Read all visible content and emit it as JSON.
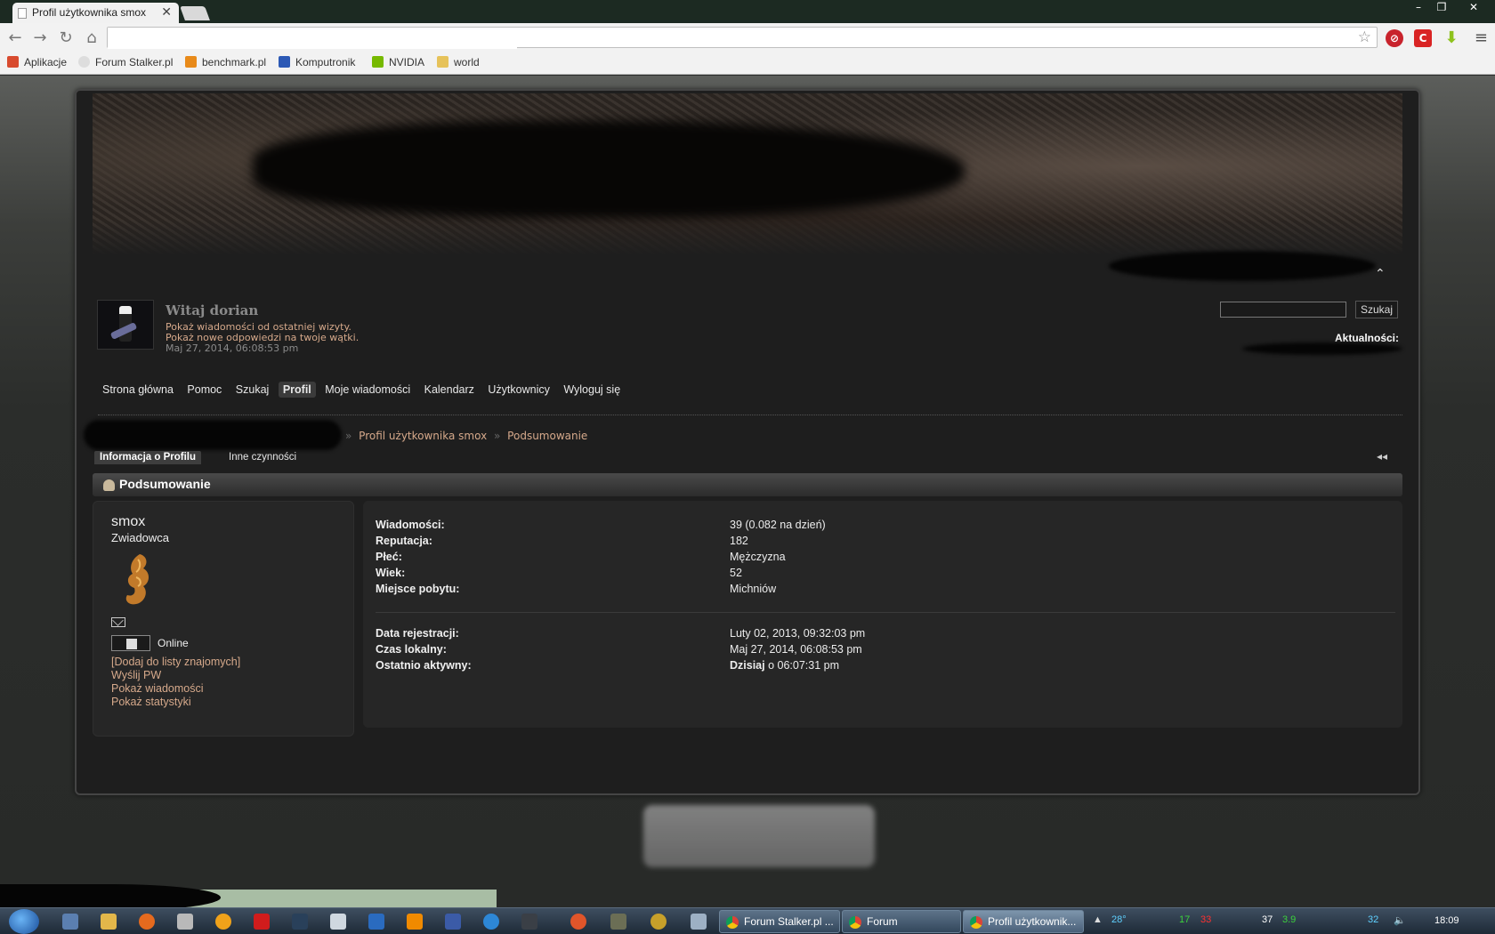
{
  "browser": {
    "tab_title": "Profil użytkownika smox",
    "tab_close": "✕",
    "window_controls": [
      "–",
      "❐",
      "✕"
    ],
    "nav_icons": [
      "back-icon",
      "forward-icon",
      "reload-icon",
      "home-icon"
    ],
    "nav_glyphs": [
      "←",
      "→",
      "↻",
      "⌂"
    ],
    "star_glyph": "☆",
    "menu_glyph": "≡",
    "extensions": [
      {
        "name": "adblock-icon",
        "glyph": "⊘",
        "color": "#c8232c"
      },
      {
        "name": "c-extension-icon",
        "glyph": "C",
        "color": "#d92424"
      },
      {
        "name": "download-icon",
        "glyph": "⬇",
        "color": "#8ec21d"
      }
    ],
    "bookmarks": [
      {
        "label": "Aplikacje",
        "icon": "apps-icon",
        "color": "#d84b2f"
      },
      {
        "label": "Forum Stalker.pl",
        "icon": "radiation-icon",
        "color": "#ffffff"
      },
      {
        "label": "benchmark.pl",
        "icon": "b-icon",
        "color": "#e88a1a"
      },
      {
        "label": "Komputronik",
        "icon": "star-icon",
        "color": "#2c59b5"
      },
      {
        "label": "NVIDIA",
        "icon": "nvidia-icon",
        "color": "#76b900"
      },
      {
        "label": "world",
        "icon": "folder-icon",
        "color": "#e6c25a"
      }
    ]
  },
  "page": {
    "header": {
      "collapse_glyph": "⌃",
      "greeting": "Witaj dorian",
      "links": [
        "Pokaż wiadomości od ostatniej wizyty.",
        "Pokaż nowe odpowiedzi na twoje wątki."
      ],
      "date": "Maj 27, 2014, 06:08:53 pm",
      "search_button": "Szukaj",
      "news_label": "Aktualności:"
    },
    "nav": [
      {
        "label": "Strona główna",
        "active": false
      },
      {
        "label": "Pomoc",
        "active": false
      },
      {
        "label": "Szukaj",
        "active": false
      },
      {
        "label": "Profil",
        "active": true
      },
      {
        "label": "Moje wiadomości",
        "active": false
      },
      {
        "label": "Kalendarz",
        "active": false
      },
      {
        "label": "Użytkownicy",
        "active": false
      },
      {
        "label": "Wyloguj się",
        "active": false
      }
    ],
    "breadcrumb": [
      "Profil użytkownika smox",
      "Podsumowanie"
    ],
    "breadcrumb_sep": "»",
    "subtabs": {
      "active": "Informacja o Profilu",
      "other": "Inne czynności",
      "collapse_glyph": "◂◂"
    },
    "section_title": "Podsumowanie",
    "user": {
      "name": "smox",
      "rank": "Zwiadowca",
      "status": "Online",
      "links": [
        "[Dodaj do listy znajomych]",
        "Wyślij PW",
        "Pokaż wiadomości",
        "Pokaż statystyki"
      ]
    },
    "stats": [
      {
        "label": "Wiadomości:",
        "value": "39 (0.082 na dzień)"
      },
      {
        "label": "Reputacja:",
        "value": "182"
      },
      {
        "label": "Płeć:",
        "value": "Mężczyzna"
      },
      {
        "label": "Wiek:",
        "value": "52"
      },
      {
        "label": "Miejsce pobytu:",
        "value": "Michniów"
      }
    ],
    "dates": [
      {
        "label": "Data rejestracji:",
        "value": "Luty 02, 2013, 09:32:03 pm"
      },
      {
        "label": "Czas lokalny:",
        "value": "Maj 27, 2014, 06:08:53 pm"
      },
      {
        "label": "Ostatnio aktywny:",
        "value_bold": "Dzisiaj",
        "value_rest": " o 06:07:31 pm"
      }
    ]
  },
  "taskbar": {
    "tasks": [
      {
        "label": "Forum Stalker.pl ...",
        "active": false
      },
      {
        "label": "Forum",
        "active": false
      },
      {
        "label": "Profil użytkownik...",
        "active": true
      }
    ],
    "tray": [
      {
        "text": "28°",
        "color": "#5fd0ff"
      },
      {
        "text": "17",
        "color": "#3cd23c"
      },
      {
        "text": "33",
        "color": "#ff3030"
      },
      {
        "text": "37",
        "color": "#ffffff"
      },
      {
        "text": "3.9",
        "color": "#3cd23c"
      },
      {
        "text": "32",
        "color": "#5fd0ff"
      }
    ],
    "clock": "18:09"
  }
}
